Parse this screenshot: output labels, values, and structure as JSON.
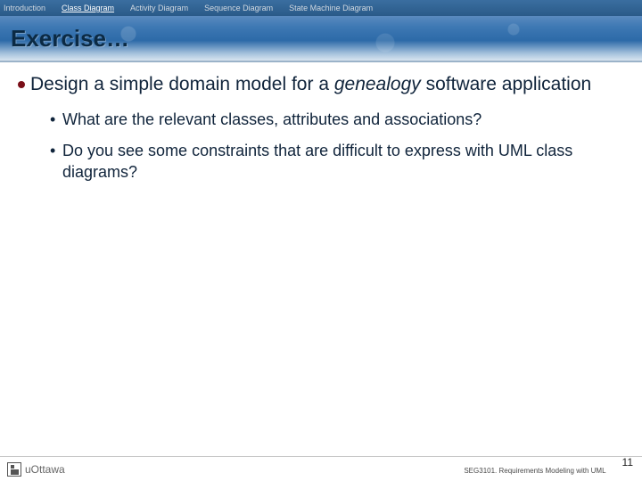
{
  "nav": {
    "items": [
      {
        "label": "Introduction",
        "active": false
      },
      {
        "label": "Class Diagram",
        "active": true
      },
      {
        "label": "Activity Diagram",
        "active": false
      },
      {
        "label": "Sequence Diagram",
        "active": false
      },
      {
        "label": "State Machine Diagram",
        "active": false
      }
    ]
  },
  "title": "Exercise…",
  "bullet": {
    "lead": "Design a simple domain model for a ",
    "emph": "genealogy",
    "tail": " software application"
  },
  "subs": [
    "What are the relevant classes, attributes and associations?",
    "Do you see some constraints that are difficult to express with UML class diagrams?"
  ],
  "footer": {
    "logo_text": "uOttawa",
    "course": "SEG3101. Requirements Modeling with UML",
    "page": "11"
  }
}
